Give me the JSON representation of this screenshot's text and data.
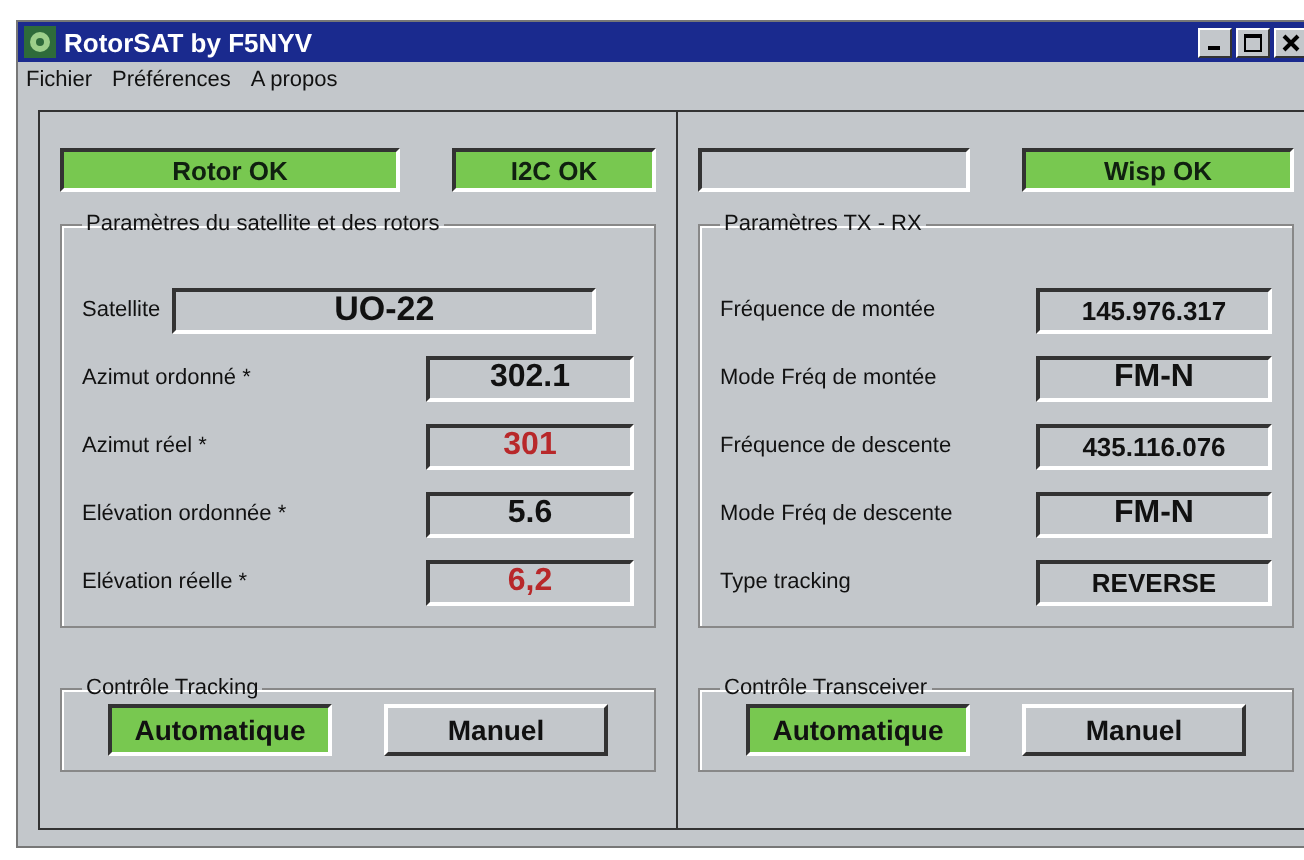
{
  "window": {
    "title": "RotorSAT by F5NYV"
  },
  "menu": [
    "Fichier",
    "Préférences",
    "A propos"
  ],
  "panels": [
    {
      "indicators": [
        {
          "label": "Rotor OK",
          "on": true
        },
        {
          "label": "I2C OK",
          "on": true
        }
      ],
      "params": {
        "title": "Paramètres du satellite et des rotors",
        "fields": [
          {
            "kind": "wide",
            "label": "Satellite",
            "value": "UO-22",
            "color": "#111111"
          },
          {
            "kind": "normal",
            "label": "Azimut ordonné *",
            "value": "302.1",
            "color": "#111111"
          },
          {
            "kind": "normal",
            "label": "Azimut réel *",
            "value": "301",
            "color": "#b8282a"
          },
          {
            "kind": "normal",
            "label": "Elévation ordonnée *",
            "value": "5.6",
            "color": "#111111"
          },
          {
            "kind": "normal",
            "label": "Elévation réelle *",
            "value": "6,2",
            "color": "#b8282a"
          }
        ]
      },
      "control": {
        "title": "Contrôle Tracking",
        "buttons": [
          {
            "label": "Automatique",
            "selected": true
          },
          {
            "label": "Manuel",
            "selected": false
          }
        ]
      }
    },
    {
      "indicators": [
        {
          "on": false
        },
        {
          "label": "Wisp OK",
          "on": true
        }
      ],
      "params": {
        "title": "Paramètres TX - RX",
        "fields": [
          {
            "kind": "small",
            "label": "Fréquence de montée",
            "value": "145.976.317",
            "color": "#111111"
          },
          {
            "kind": "normal",
            "label": "Mode Fréq de montée",
            "value": "FM-N",
            "color": "#111111"
          },
          {
            "kind": "small",
            "label": "Fréquence de descente",
            "value": "435.116.076",
            "color": "#111111"
          },
          {
            "kind": "normal",
            "label": "Mode Fréq de descente",
            "value": "FM-N",
            "color": "#111111"
          },
          {
            "kind": "small",
            "label": "Type tracking",
            "value": "REVERSE",
            "color": "#111111"
          }
        ]
      },
      "control": {
        "title": "Contrôle Transceiver",
        "buttons": [
          {
            "label": "Automatique",
            "selected": true
          },
          {
            "label": "Manuel",
            "selected": false
          }
        ]
      }
    }
  ]
}
